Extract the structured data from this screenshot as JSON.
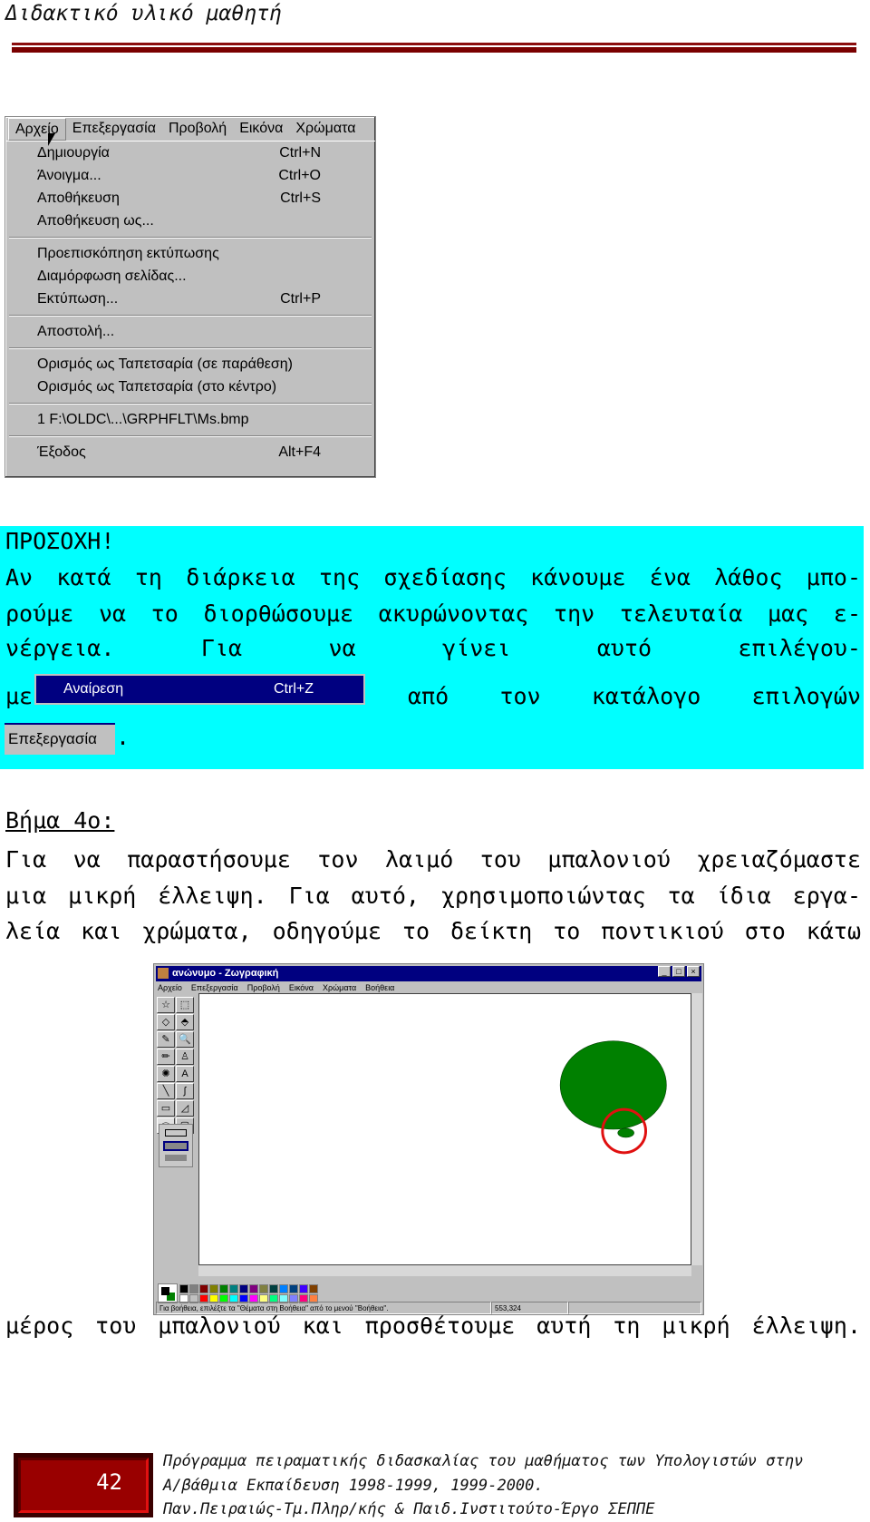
{
  "header": {
    "title": "Διδακτικό υλικό μαθητή",
    "rule_color": "#7a0000"
  },
  "file_menu": {
    "menubar": [
      "Αρχείο",
      "Επεξεργασία",
      "Προβολή",
      "Εικόνα",
      "Χρώματα"
    ],
    "groups": [
      [
        {
          "label": "Δημιουργία",
          "shortcut": "Ctrl+N"
        },
        {
          "label": "Άνοιγμα...",
          "shortcut": "Ctrl+O"
        },
        {
          "label": "Αποθήκευση",
          "shortcut": "Ctrl+S"
        },
        {
          "label": "Αποθήκευση ως...",
          "shortcut": ""
        }
      ],
      [
        {
          "label": "Προεπισκόπηση εκτύπωσης",
          "shortcut": ""
        },
        {
          "label": "Διαμόρφωση σελίδας...",
          "shortcut": ""
        },
        {
          "label": "Εκτύπωση...",
          "shortcut": "Ctrl+P"
        }
      ],
      [
        {
          "label": "Αποστολή...",
          "shortcut": ""
        }
      ],
      [
        {
          "label": "Ορισμός ως Ταπετσαρία (σε παράθεση)",
          "shortcut": ""
        },
        {
          "label": "Ορισμός ως Ταπετσαρία (στο κέντρο)",
          "shortcut": ""
        }
      ],
      [
        {
          "label": "1 F:\\OLDC\\...\\GRPHFLT\\Ms.bmp",
          "shortcut": ""
        }
      ],
      [
        {
          "label": "Έξοδος",
          "shortcut": "Alt+F4"
        }
      ]
    ]
  },
  "note": {
    "background": "#00ffff",
    "title": "ΠΡΟΣΟΧΗ!",
    "lines": [
      "Αν κατά τη διάρκεια της σχεδίασης κάνουμε ένα λάθος μπο-",
      "ρούμε να το διορθώσουμε ακυρώνοντας την τελευταία μας ε-",
      "νέργεια. Για να γίνει αυτό επιλέγου-"
    ],
    "line4_start": "με",
    "line4_end": "από τον κατάλογο επιλογών",
    "undo_item": {
      "label": "Αναίρεση",
      "shortcut": "Ctrl+Z"
    },
    "edit_menu": "Επεξεργασία",
    "period": "."
  },
  "step": {
    "heading": "Βήμα 4ο:",
    "lines": [
      "Για να παραστήσουμε τον λαιμό του μπαλονιού χρειαζόμαστε",
      "μια μικρή έλλειψη. Για αυτό, χρησιμοποιώντας τα ίδια εργα-",
      "λεία και χρώματα, οδηγούμε το δείκτη το ποντικιού στο κάτω"
    ],
    "after": "μέρος του μπαλονιού και προσθέτουμε αυτή τη μικρή έλλειψη."
  },
  "paint": {
    "title": "ανώνυμο - Ζωγραφική",
    "menus": [
      "Αρχείο",
      "Επεξεργασία",
      "Προβολή",
      "Εικόνα",
      "Χρώματα",
      "Βοήθεια"
    ],
    "tools": [
      "☆",
      "⬚",
      "◇",
      "⬘",
      "✎",
      "🔍",
      "✏",
      "♙",
      "✺",
      "A",
      "╲",
      "∫",
      "▭",
      "◿",
      "⬭",
      "▢"
    ],
    "palette_top": [
      "#000000",
      "#808080",
      "#800000",
      "#808000",
      "#008000",
      "#008080",
      "#000080",
      "#800080",
      "#808040",
      "#004040",
      "#0080ff",
      "#004080",
      "#4000ff",
      "#804000"
    ],
    "palette_bottom": [
      "#ffffff",
      "#c0c0c0",
      "#ff0000",
      "#ffff00",
      "#00ff00",
      "#00ffff",
      "#0000ff",
      "#ff00ff",
      "#ffff80",
      "#00ff80",
      "#80ffff",
      "#8080ff",
      "#ff0080",
      "#ff8040"
    ],
    "status": "Για βοήθεια, επιλέξτε τα \"Θέματα στη Βοήθεια\" από το μενού \"Βοήθεια\".",
    "coords": "553,324",
    "balloon_color": "#008000",
    "highlight_color": "#e01010"
  },
  "footer": {
    "page": "42",
    "lines": [
      "Πρόγραμμα πειραματικής διδασκαλίας του μαθήματος των Υπολογιστών στην",
      "Α/βάθμια Εκπαίδευση 1998-1999, 1999-2000.",
      "Παν.Πειραιώς-Τμ.Πληρ/κής & Παιδ.Ινστιτούτο-Έργο ΣΕΠΠΕ"
    ]
  }
}
